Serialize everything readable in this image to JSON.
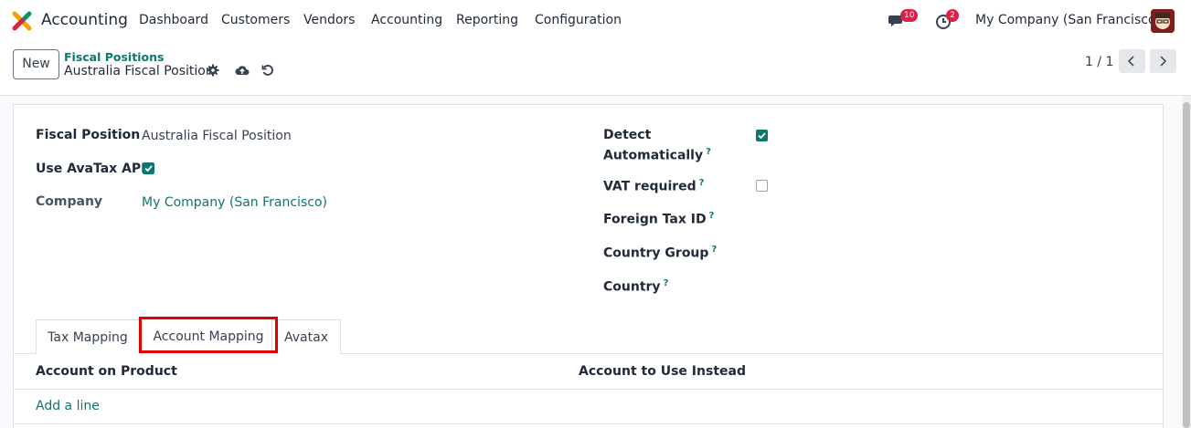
{
  "navbar": {
    "app_name": "Accounting",
    "menu": [
      "Dashboard",
      "Customers",
      "Vendors",
      "Accounting",
      "Reporting",
      "Configuration"
    ],
    "messages_count": "10",
    "activities_count": "2",
    "company": "My Company (San Francisco)"
  },
  "control_panel": {
    "new_label": "New",
    "breadcrumb_parent": "Fiscal Positions",
    "breadcrumb_current": "Australia Fiscal Position",
    "pager": "1 / 1"
  },
  "form": {
    "fiscal_position_label": "Fiscal Position",
    "fiscal_position_value": "Australia Fiscal Position",
    "use_avatax_label": "Use AvaTax API",
    "use_avatax_checked": true,
    "company_label": "Company",
    "company_value": "My Company (San Francisco)",
    "detect_label_1": "Detect",
    "detect_label_2": "Automatically",
    "detect_checked": true,
    "vat_required_label": "VAT required",
    "vat_required_checked": false,
    "foreign_tax_id_label": "Foreign Tax ID",
    "country_group_label": "Country Group",
    "country_label": "Country",
    "help_mark": "?"
  },
  "tabs": [
    "Tax Mapping",
    "Account Mapping",
    "Avatax"
  ],
  "active_tab": "Account Mapping",
  "table": {
    "columns": [
      "Account on Product",
      "Account to Use Instead"
    ],
    "add_line": "Add a line"
  },
  "colors": {
    "accent": "#0f766e",
    "badge": "#e11d48",
    "highlight": "#e00000"
  }
}
